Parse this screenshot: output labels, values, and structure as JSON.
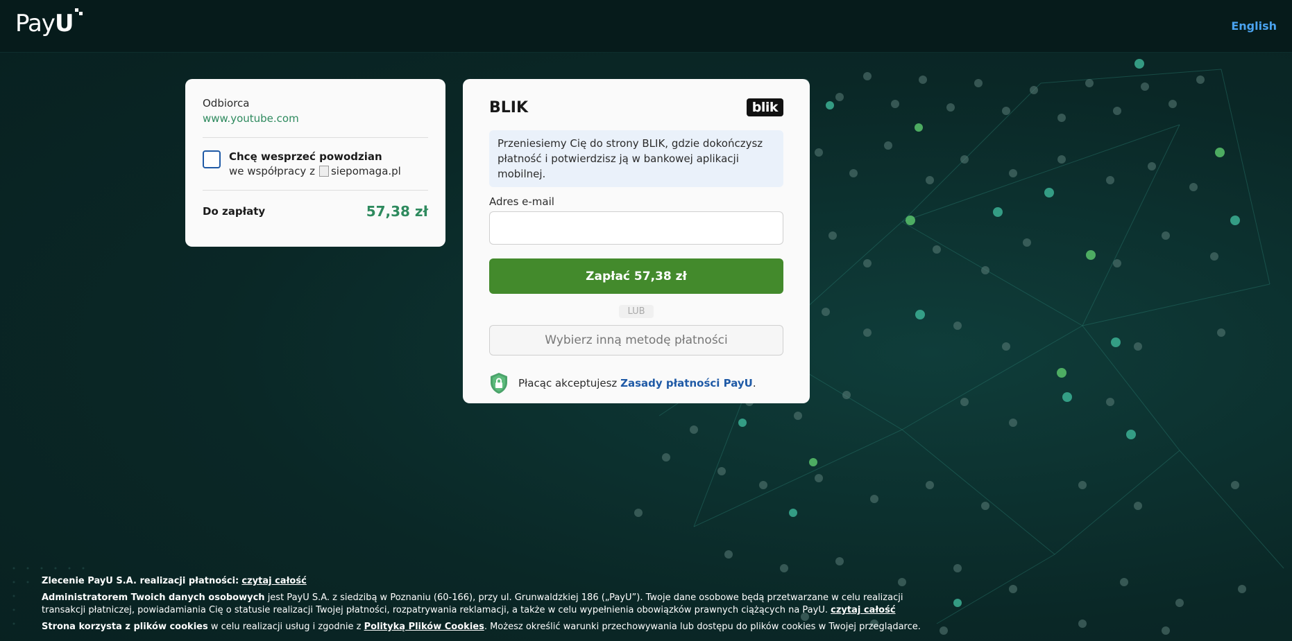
{
  "header": {
    "logo_text": "PayU",
    "language_link": "English"
  },
  "summary": {
    "recipient_label": "Odbiorca",
    "recipient_value": "www.youtube.com",
    "donation_title": "Chcę wesprzeć powodzian",
    "donation_partner_prefix": "we współpracy z",
    "donation_partner_img_alt": "siepomaga.pl",
    "donation_checked": false,
    "total_label": "Do zapłaty",
    "total_value": "57,38 zł"
  },
  "blik": {
    "title": "BLIK",
    "logo_text": "blik",
    "info_text": "Przeniesiemy Cię do strony BLIK, gdzie dokończysz płatność i potwierdzisz ją w bankowej aplikacji mobilnej.",
    "email_label": "Adres e-mail",
    "email_value": "",
    "pay_button": "Zapłać 57,38 zł",
    "or_label": "LUB",
    "alt_method_button": "Wybierz inną metodę płatności",
    "terms_prefix": "Płacąc akceptujesz",
    "terms_link": "Zasady płatności PayU",
    "terms_suffix": "."
  },
  "footer": {
    "line1_bold": "Zlecenie PayU S.A. realizacji płatności:",
    "line1_link": "czytaj całość",
    "line2_bold": "Administratorem Twoich danych osobowych",
    "line2_text": " jest PayU S.A. z siedzibą w Poznaniu (60-166), przy ul. Grunwaldzkiej 186 („PayU”). Twoje dane osobowe będą przetwarzane w celu realizacji transakcji płatniczej, powiadamiania Cię o statusie realizacji Twojej płatności, rozpatrywania reklamacji, a także w celu wypełnienia obowiązków prawnych ciążących na PayU.",
    "line2_link": "czytaj całość",
    "line3_bold": "Strona korzysta z plików cookies",
    "line3_text1": " w celu realizacji usług i zgodnie z ",
    "line3_link": "Polityką Plików Cookies",
    "line3_text2": ". Możesz określić warunki przechowywania lub dostępu do plików cookies w Twojej przeglądarce."
  },
  "colors": {
    "brand_green": "#438a2c",
    "amount_green": "#2e8a5e",
    "link_blue": "#1f5aa6",
    "language_blue": "#4aa3f0",
    "background": "#0b2727"
  }
}
